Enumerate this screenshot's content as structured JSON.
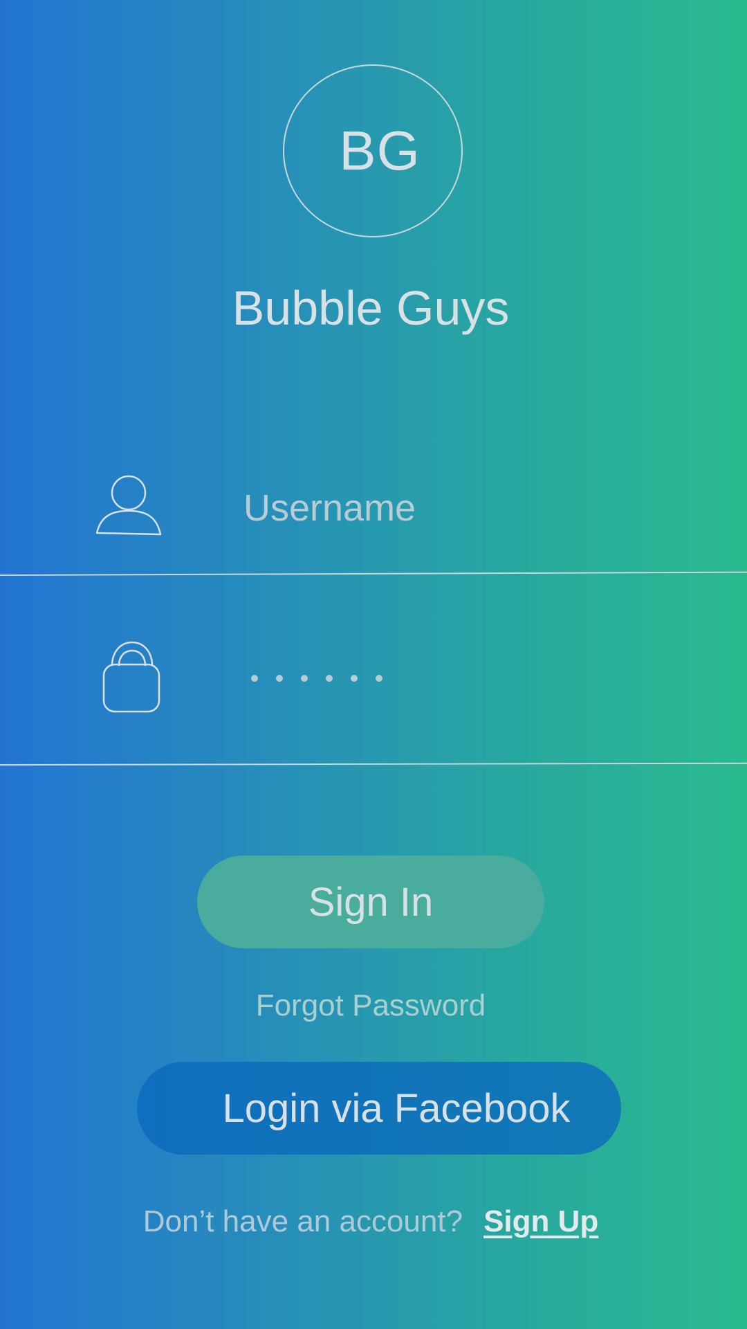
{
  "logo": {
    "initials": "BG",
    "app_name": "Bubble Guys"
  },
  "form": {
    "username": {
      "placeholder": "Username",
      "value": "",
      "icon": "user-icon"
    },
    "password": {
      "masked_length": 6,
      "icon": "lock-icon"
    }
  },
  "actions": {
    "sign_in_label": "Sign In",
    "forgot_password_label": "Forgot Password",
    "facebook_label": "Login via Facebook"
  },
  "footer": {
    "no_account_text": "Don’t have an account?",
    "sign_up_label": "Sign Up"
  },
  "colors": {
    "gradient_start": "#2374d2",
    "gradient_end": "#2aba8e",
    "sign_in_button": "#4aac9c",
    "facebook_button": "#0f6ebd",
    "text": "#d8e2e6"
  }
}
